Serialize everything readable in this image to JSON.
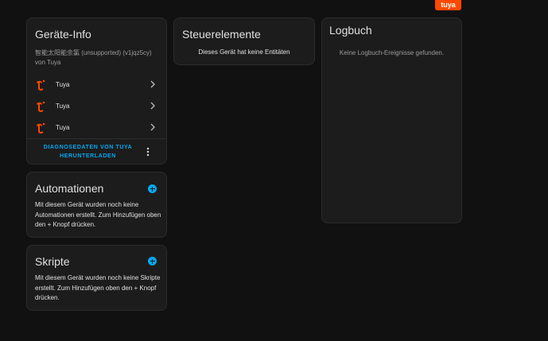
{
  "brand": {
    "logo_text": "tuya",
    "color": "#ff4800"
  },
  "accent_color": "#03a9f4",
  "device_info": {
    "title": "Geräte-Info",
    "model": "智能太阳能余氯 (unsupported) (v1jqz5cy)",
    "manufacturer": "von Tuya",
    "rows": [
      {
        "label": "Tuya",
        "icon": "tuya-icon"
      },
      {
        "label": "Tuya",
        "icon": "tuya-icon"
      },
      {
        "label": "Tuya",
        "icon": "tuya-icon"
      }
    ],
    "download_label_line1": "DIAGNOSEDATEN VON TUYA",
    "download_label_line2": "HERUNTERLADEN",
    "menu_icon": "more-vertical-icon"
  },
  "automations": {
    "title": "Automationen",
    "text": "Mit diesem Gerät wurden noch keine Automationen erstellt. Zum Hinzufügen oben den + Knopf drücken."
  },
  "scripts": {
    "title": "Skripte",
    "text": "Mit diesem Gerät wurden noch keine Skripte erstellt. Zum Hinzufügen oben den + Knopf drücken."
  },
  "controls": {
    "title": "Steuerelemente",
    "text": "Dieses Gerät hat keine Entitäten"
  },
  "logbook": {
    "title": "Logbuch",
    "text": "Keine Logbuch-Ereignisse gefunden."
  }
}
